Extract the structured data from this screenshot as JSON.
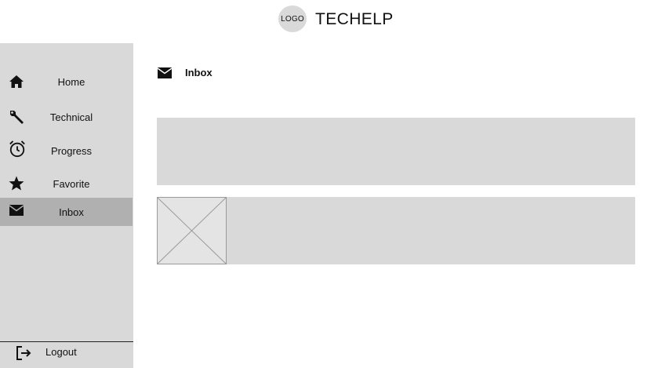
{
  "header": {
    "logo_text": "LOGO",
    "app_title": "TECHELP"
  },
  "sidebar": {
    "items": [
      {
        "label": "Home",
        "icon": "home-icon"
      },
      {
        "label": "Technical",
        "icon": "wrench-icon"
      },
      {
        "label": "Progress",
        "icon": "alarm-clock-icon"
      },
      {
        "label": "Favorite",
        "icon": "star-icon"
      },
      {
        "label": "Inbox",
        "icon": "envelope-icon",
        "active": true
      }
    ],
    "logout_label": "Logout"
  },
  "main": {
    "title": "Inbox",
    "title_icon": "envelope-icon"
  },
  "colors": {
    "panel_gray": "#d9d9d9",
    "active_gray": "#b0b0b0"
  }
}
